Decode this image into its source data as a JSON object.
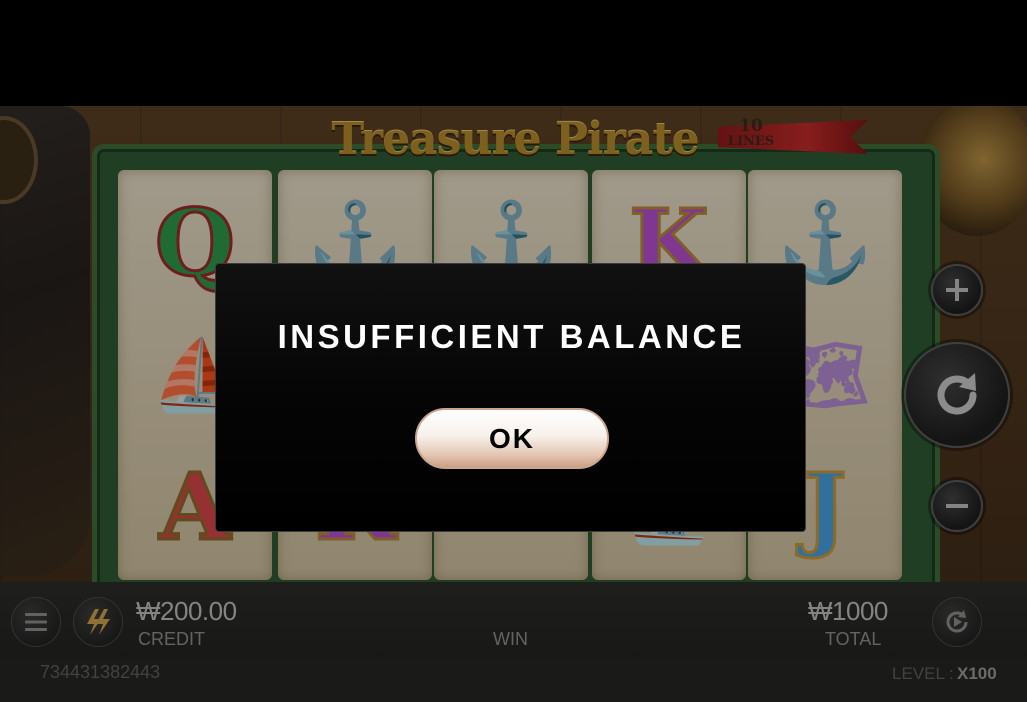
{
  "game": {
    "title": "Treasure Pirate",
    "lines_count": "10",
    "lines_label": "LINES",
    "reels": [
      [
        "Q",
        "ship",
        "A"
      ],
      [
        "anchor",
        "",
        "K"
      ],
      [
        "anchor",
        "",
        ""
      ],
      [
        "K",
        "",
        "ship"
      ],
      [
        "anchor",
        "map",
        "J"
      ]
    ]
  },
  "bottom_bar": {
    "credit_amount": "₩200.00",
    "credit_label": "CREDIT",
    "win_label": "WIN",
    "total_amount": "₩1000",
    "total_label": "TOTAL"
  },
  "status_bar": {
    "session_id": "734431382443",
    "level_label": "LEVEL :",
    "level_value": "X100"
  },
  "modal": {
    "title": "INSUFFICIENT BALANCE",
    "ok_label": "OK"
  },
  "colors": {
    "modal_background": "#000000",
    "ok_button": "#f4e4da",
    "table_felt": "#2f5a34"
  },
  "icons": [
    "menu-icon",
    "turbo-icon",
    "plus-icon",
    "spin-icon",
    "minus-icon",
    "autoplay-icon"
  ]
}
